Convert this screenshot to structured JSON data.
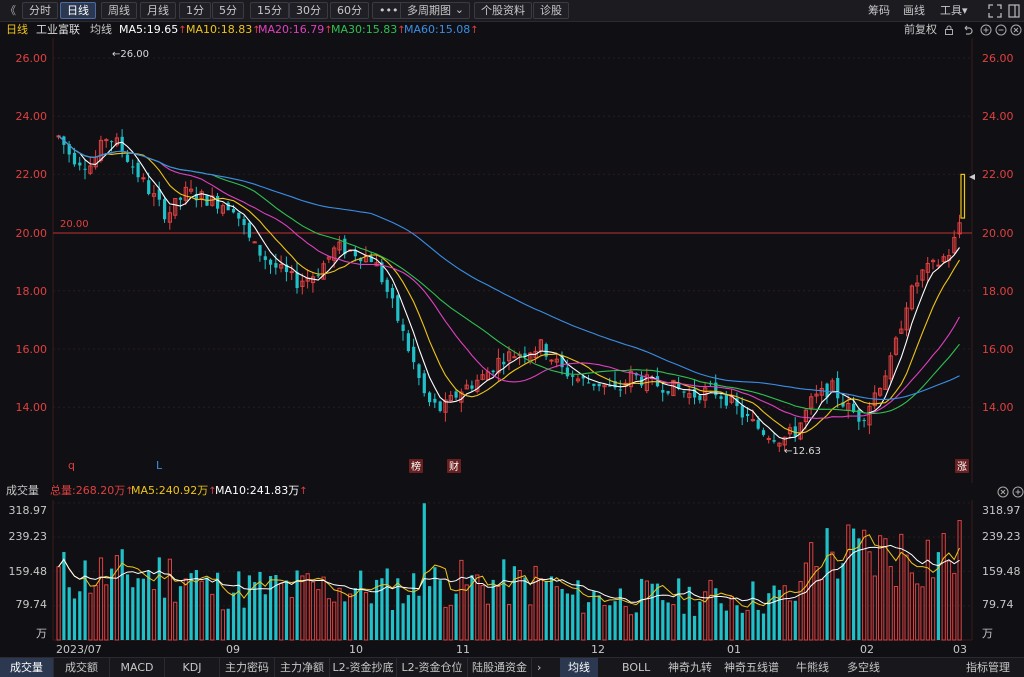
{
  "toolbar": {
    "back_glyph": "《",
    "buttons": [
      "分时",
      "日线",
      "周线",
      "月线",
      "1分",
      "5分",
      "15分",
      "30分",
      "60分",
      "•••",
      "多周期图",
      "个股资料",
      "诊股"
    ],
    "multi_period_caret": "⌄",
    "right": [
      "筹码",
      "画线",
      "工具"
    ],
    "tools_caret": "▾"
  },
  "ma_header": {
    "period": "日线",
    "stock_name": "工业富联",
    "avg_label": "均线",
    "ma5": "MA5:19.65",
    "ma10": "MA10:18.83",
    "ma20": "MA20:16.79",
    "ma30": "MA30:15.83",
    "ma60": "MA60:15.08",
    "up_arrow": "↑",
    "adjust": "前复权",
    "colors": {
      "ma5": "#ffffff",
      "ma10": "#f0c419",
      "ma20": "#e040c0",
      "ma30": "#30c050",
      "ma60": "#3a8ee6"
    }
  },
  "price_axis": {
    "ticks": [
      "26.00",
      "24.00",
      "22.00",
      "20.00",
      "18.00",
      "16.00",
      "14.00"
    ],
    "ref_line_label": "20.00",
    "high_label": "←26.00",
    "low_label": "←12.63",
    "marker_q": "q",
    "marker_l": "L",
    "badges": [
      "榜",
      "财",
      "涨"
    ]
  },
  "volume_header": {
    "title": "成交量",
    "total": "总量:268.20万",
    "ma5": "MA5:240.92万",
    "ma10": "MA10:241.83万",
    "up_arrow": "↑"
  },
  "volume_axis": {
    "ticks": [
      "318.97",
      "239.23",
      "159.48",
      "79.74"
    ],
    "unit": "万"
  },
  "date_axis": [
    "2023/07",
    "09",
    "10",
    "11",
    "12",
    "01",
    "02",
    "03"
  ],
  "tabs_left": [
    "成交量",
    "成交额",
    "MACD",
    "KDJ",
    "主力密码",
    "主力净额",
    "L2-资金抄底",
    "L2-资金仓位",
    "陆股通资金"
  ],
  "tabs_right": [
    "均线",
    "BOLL",
    "神奇九转",
    "神奇五线谱",
    "牛熊线",
    "多空线"
  ],
  "tabs_settings": "指标管理",
  "tabs_nav_glyph": "›"
}
